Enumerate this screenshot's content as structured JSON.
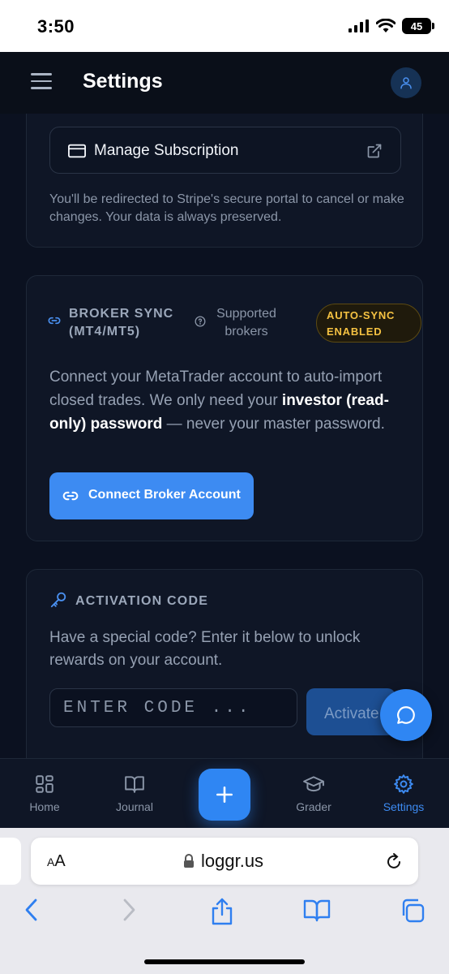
{
  "status_bar": {
    "time": "3:50",
    "battery": "45"
  },
  "header": {
    "title": "Settings",
    "menu_icon": "hamburger-menu-icon",
    "avatar_icon": "user-icon"
  },
  "subscription": {
    "manage_label": "Manage Subscription",
    "note": "You'll be redirected to Stripe's secure portal to cancel or make changes. Your data is always preserved."
  },
  "broker_sync": {
    "title": "BROKER SYNC (MT4/MT5)",
    "supported_label": "Supported brokers",
    "badge": "AUTO-SYNC ENABLED",
    "desc_before": "Connect your MetaTrader account to auto-import closed trades. We only need your ",
    "desc_bold": "investor (read-only) password",
    "desc_after": " — never your master password.",
    "connect_label": "Connect Broker Account"
  },
  "activation": {
    "title": "ACTIVATION CODE",
    "desc": "Have a special code? Enter it below to unlock rewards on your account.",
    "placeholder": "ENTER CODE ...",
    "value": "",
    "activate_label": "Activate"
  },
  "bottom_nav": {
    "items": [
      {
        "label": "Home",
        "icon": "grid-icon"
      },
      {
        "label": "Journal",
        "icon": "book-icon"
      },
      {
        "label": "Grader",
        "icon": "graduation-cap-icon"
      },
      {
        "label": "Settings",
        "icon": "gear-icon",
        "active": true
      }
    ],
    "add_icon": "plus-icon"
  },
  "browser": {
    "text_size_label": "AA",
    "url": "loggr.us"
  },
  "colors": {
    "accent": "#2f86f3",
    "background": "#0b1120",
    "card": "#0f1626",
    "badge_text": "#f5c242"
  }
}
